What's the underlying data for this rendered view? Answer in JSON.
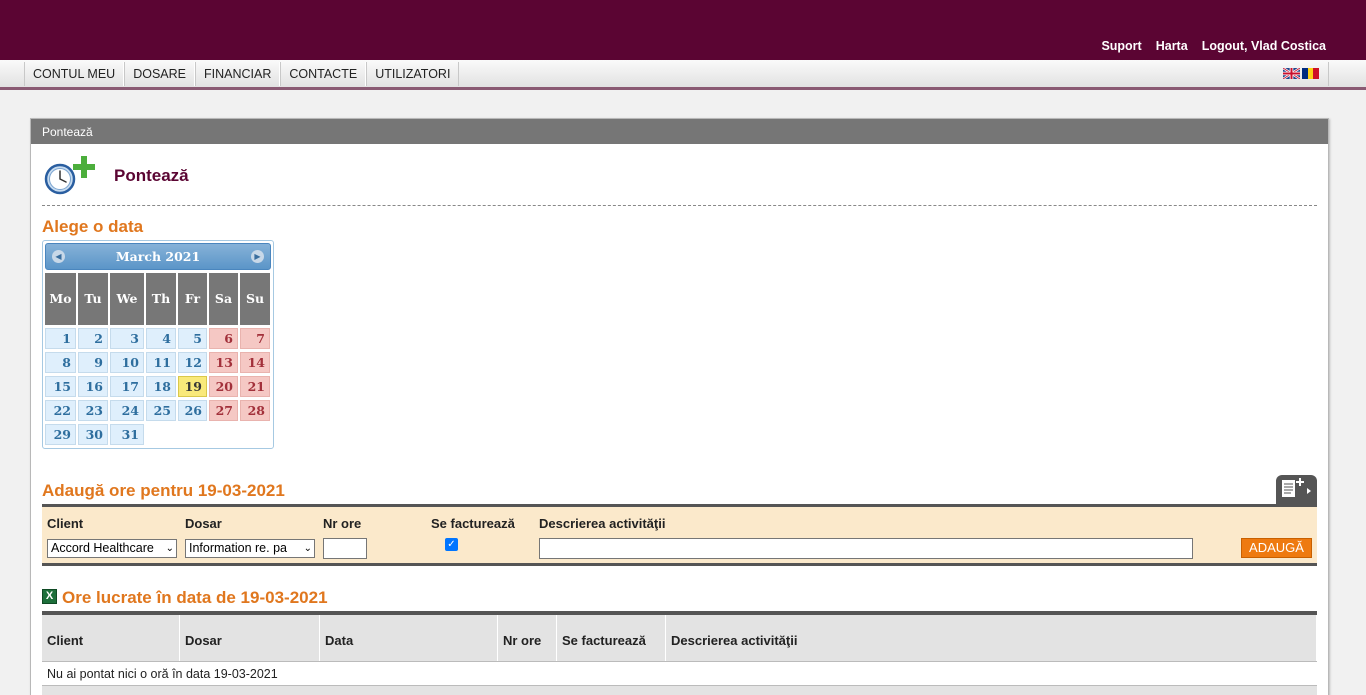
{
  "header": {
    "links": [
      "Suport",
      "Harta",
      "Logout, Vlad Costica"
    ]
  },
  "nav": {
    "items": [
      "CONTUL MEU",
      "DOSARE",
      "FINANCIAR",
      "CONTACTE",
      "UTILIZATORI"
    ],
    "languages": [
      "en-flag-icon",
      "ro-flag-icon"
    ]
  },
  "panel": {
    "header": "Pontează",
    "title": "Pontează"
  },
  "calendar": {
    "section_title": "Alege o data",
    "month_label": "March 2021",
    "days_of_week": [
      "Mo",
      "Tu",
      "We",
      "Th",
      "Fr",
      "Sa",
      "Su"
    ],
    "weeks": [
      [
        "1",
        "2",
        "3",
        "4",
        "5",
        "6",
        "7"
      ],
      [
        "8",
        "9",
        "10",
        "11",
        "12",
        "13",
        "14"
      ],
      [
        "15",
        "16",
        "17",
        "18",
        "19",
        "20",
        "21"
      ],
      [
        "22",
        "23",
        "24",
        "25",
        "26",
        "27",
        "28"
      ],
      [
        "29",
        "30",
        "31",
        "",
        "",
        "",
        ""
      ]
    ],
    "selected_day": "19"
  },
  "add_form": {
    "section_title": "Adaugă ore pentru 19-03-2021",
    "labels": {
      "client": "Client",
      "dosar": "Dosar",
      "nr_ore": "Nr ore",
      "se_factureaza": "Se facturează",
      "descriere": "Descrierea activităţii"
    },
    "client_value": "Accord Healthcare",
    "dosar_value": "Information re. pa",
    "nr_ore_value": "",
    "se_factureaza_checked": true,
    "descriere_value": "",
    "submit_label": "ADAUGĂ"
  },
  "worked_hours": {
    "section_title": "Ore lucrate în data de 19-03-2021",
    "columns": [
      "Client",
      "Dosar",
      "Data",
      "Nr ore",
      "Se facturează",
      "Descrierea activităţii"
    ],
    "empty_message": "Nu ai pontat nici o oră în data 19-03-2021"
  },
  "colors": {
    "brand": "#5b0533",
    "accent": "#e0771e",
    "button": "#ee7a10"
  }
}
